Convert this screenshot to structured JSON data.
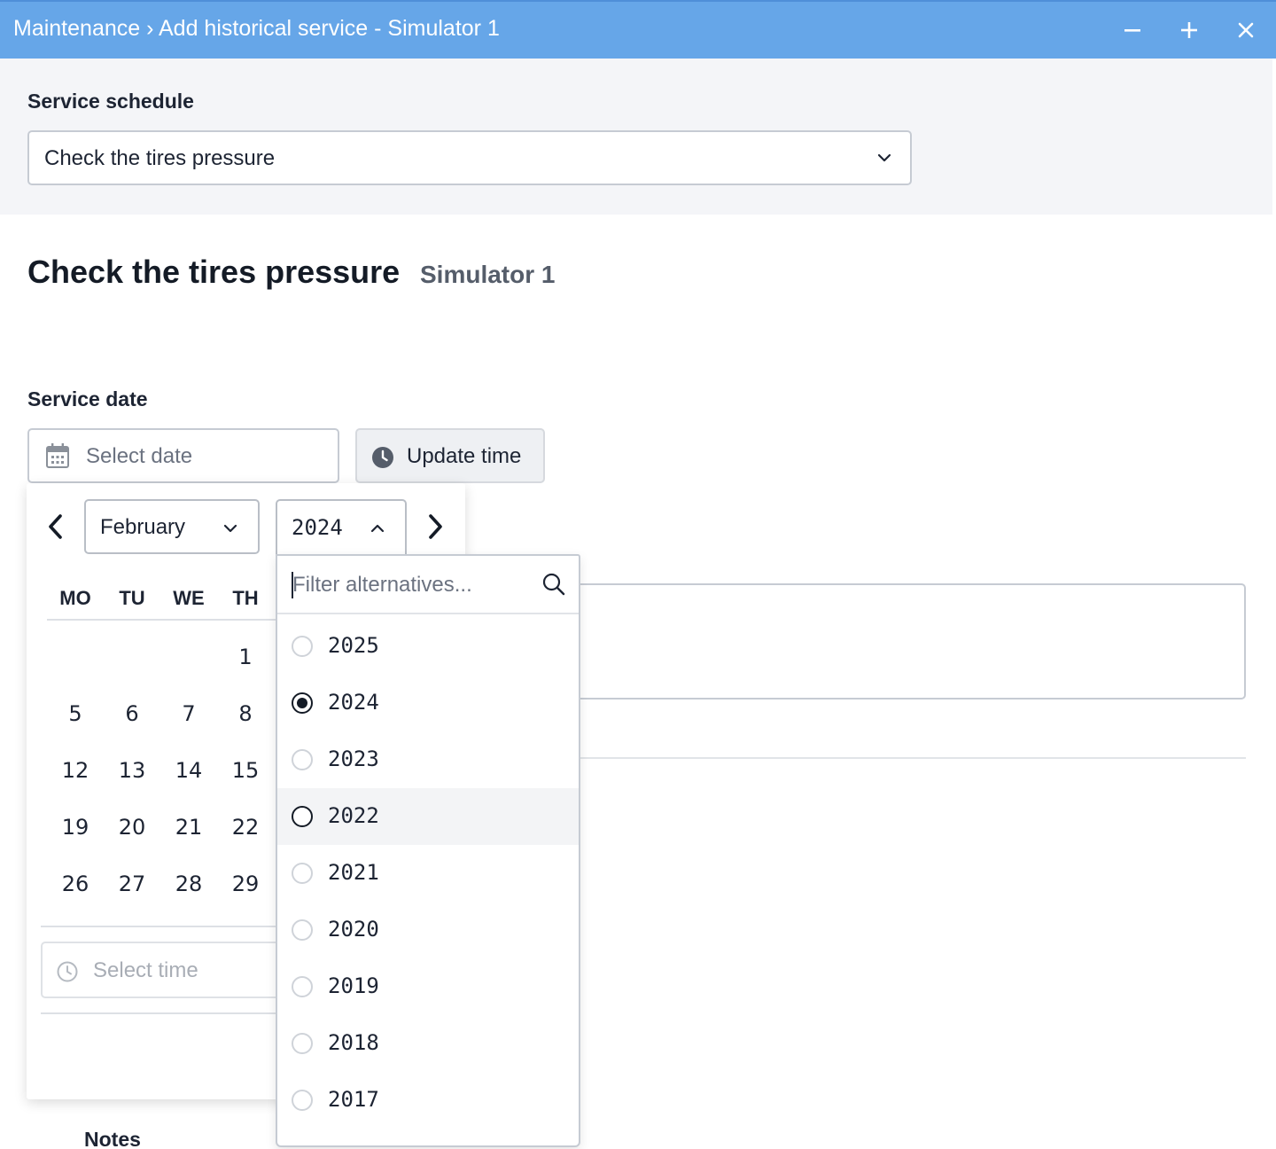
{
  "window": {
    "title": "Maintenance › Add historical service - Simulator 1",
    "minimize_icon": "minus-icon",
    "maximize_icon": "plus-icon",
    "close_icon": "close-icon"
  },
  "service_schedule": {
    "label": "Service schedule",
    "selected": "Check the tires pressure"
  },
  "heading": {
    "title": "Check the tires pressure",
    "subtitle": "Simulator 1"
  },
  "service_date": {
    "label": "Service date",
    "date_placeholder": "Select date",
    "update_time_label": "Update time"
  },
  "calendar": {
    "month": "February",
    "year": "2024",
    "weekdays": [
      "MO",
      "TU",
      "WE",
      "TH"
    ],
    "weeks": [
      [
        "",
        "",
        "",
        "1"
      ],
      [
        "5",
        "6",
        "7",
        "8"
      ],
      [
        "12",
        "13",
        "14",
        "15"
      ],
      [
        "19",
        "20",
        "21",
        "22"
      ],
      [
        "26",
        "27",
        "28",
        "29"
      ]
    ],
    "time_placeholder": "Select time"
  },
  "year_dropdown": {
    "filter_placeholder": "Filter alternatives...",
    "selected": "2024",
    "highlighted": "2022",
    "options": [
      "2025",
      "2024",
      "2023",
      "2022",
      "2021",
      "2020",
      "2019",
      "2018",
      "2017"
    ]
  },
  "notes": {
    "label": "Notes"
  },
  "colors": {
    "titlebar": "#66a6e8",
    "panel_bg": "#f4f5f8",
    "text": "#1d2433"
  }
}
